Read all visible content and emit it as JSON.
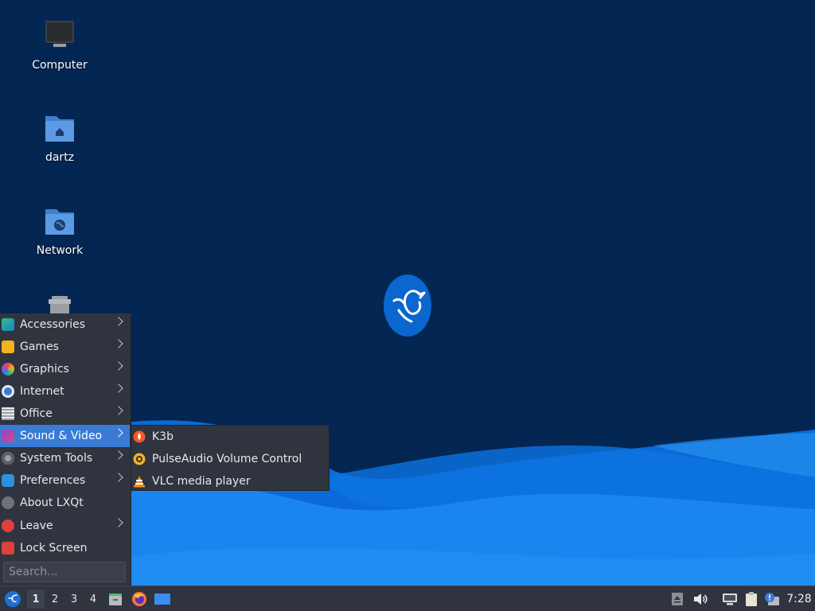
{
  "desktop": {
    "icons": [
      {
        "label": "Computer"
      },
      {
        "label": "dartz"
      },
      {
        "label": "Network"
      },
      {
        "label": "Trash"
      }
    ]
  },
  "menu": {
    "items": [
      {
        "label": "Accessories",
        "icon": "accessories-icon",
        "has_submenu": true
      },
      {
        "label": "Games",
        "icon": "games-icon",
        "has_submenu": true
      },
      {
        "label": "Graphics",
        "icon": "graphics-icon",
        "has_submenu": true
      },
      {
        "label": "Internet",
        "icon": "internet-icon",
        "has_submenu": true
      },
      {
        "label": "Office",
        "icon": "office-icon",
        "has_submenu": true
      },
      {
        "label": "Sound & Video",
        "icon": "sound-video-icon",
        "has_submenu": true,
        "active": true
      },
      {
        "label": "System Tools",
        "icon": "system-tools-icon",
        "has_submenu": true
      },
      {
        "label": "Preferences",
        "icon": "preferences-icon",
        "has_submenu": true
      },
      {
        "label": "About LXQt",
        "icon": "info-icon",
        "has_submenu": false
      },
      {
        "label": "Leave",
        "icon": "power-icon",
        "has_submenu": true
      },
      {
        "label": "Lock Screen",
        "icon": "lock-icon",
        "has_submenu": false
      }
    ],
    "search_placeholder": "Search..."
  },
  "submenu": {
    "items": [
      {
        "label": "K3b",
        "icon": "k3b-icon"
      },
      {
        "label": "PulseAudio Volume Control",
        "icon": "pulseaudio-icon"
      },
      {
        "label": "VLC media player",
        "icon": "vlc-icon"
      }
    ]
  },
  "taskbar": {
    "workspaces": [
      "1",
      "2",
      "3",
      "4"
    ],
    "active_workspace": "1",
    "clock": "7:28"
  },
  "colors": {
    "desktop_bg": "#042652",
    "wave_light": "#1e8ef0",
    "wave_dark": "#0a5fd0",
    "panel_bg": "#2f343f",
    "highlight": "#3a7bd5"
  }
}
